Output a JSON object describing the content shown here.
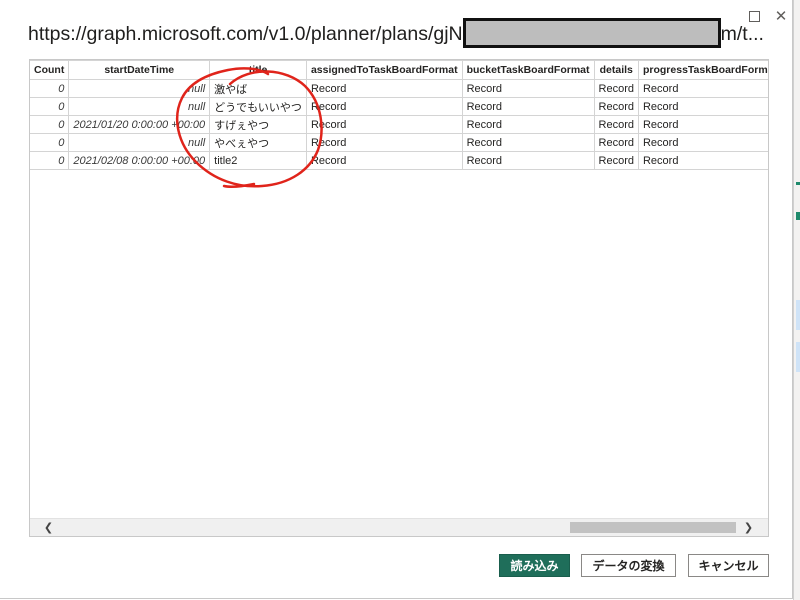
{
  "dialog": {
    "url_title_prefix": "https://graph.microsoft.com/v1.0/planner/plans/gjN",
    "url_title_suffix": "m/t...",
    "maximize_icon": "maximize-icon",
    "close_icon": "close-icon",
    "close_glyph": "✕"
  },
  "table": {
    "columns": [
      "Count",
      "startDateTime",
      "title",
      "assignedToTaskBoardFormat",
      "bucketTaskBoardFormat",
      "details",
      "progressTaskBoardFormat"
    ],
    "rows": [
      [
        "0",
        "null",
        "激やば",
        "Record",
        "Record",
        "Record",
        "Record"
      ],
      [
        "0",
        "null",
        "どうでもいいやつ",
        "Record",
        "Record",
        "Record",
        "Record"
      ],
      [
        "0",
        "2021/01/20 0:00:00 +00:00",
        "すげぇやつ",
        "Record",
        "Record",
        "Record",
        "Record"
      ],
      [
        "0",
        "null",
        "やべぇやつ",
        "Record",
        "Record",
        "Record",
        "Record"
      ],
      [
        "0",
        "2021/02/08 0:00:00 +00:00",
        "title2",
        "Record",
        "Record",
        "Record",
        "Record"
      ]
    ]
  },
  "scrollbar": {
    "left_glyph": "❮",
    "right_glyph": "❯"
  },
  "buttons": {
    "load": "読み込み",
    "transform": "データの変換",
    "cancel": "キャンセル"
  },
  "colors": {
    "primary_button": "#1f6e5a",
    "annotation_red": "#e0241b"
  }
}
